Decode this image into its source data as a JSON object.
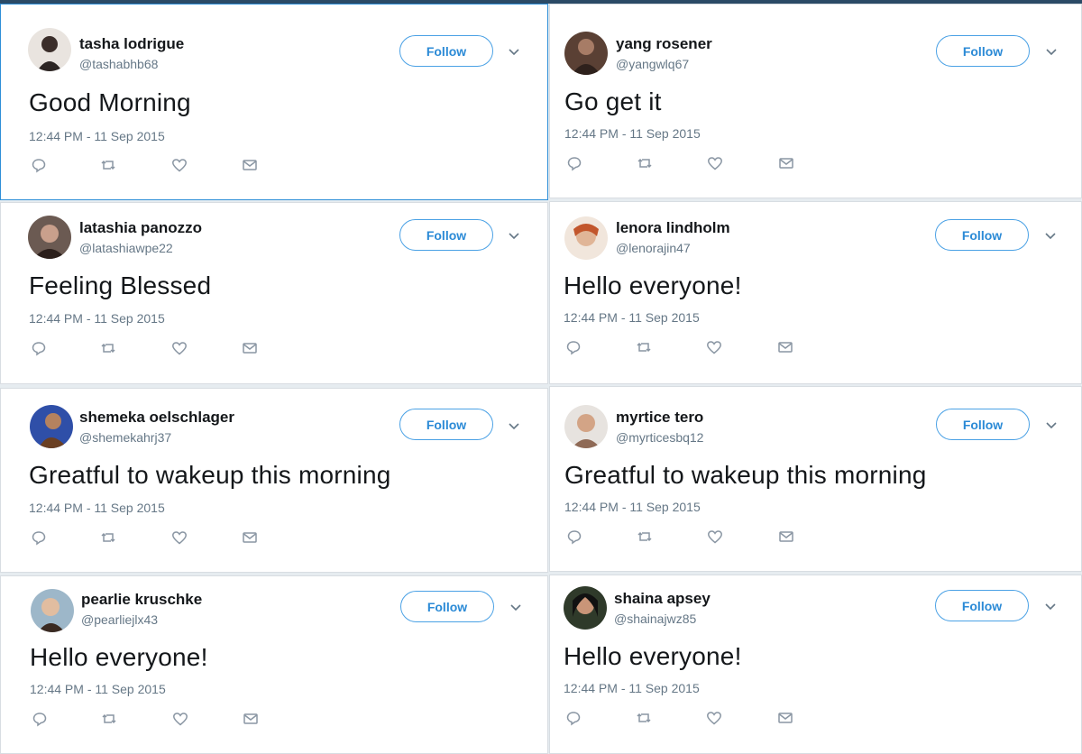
{
  "colors": {
    "accent": "#1da1f2",
    "follow_border": "#4aa1e5",
    "text": "#14171a",
    "muted": "#657786",
    "selected_border": "#2f8fd8"
  },
  "icons": [
    "reply-icon",
    "retweet-icon",
    "like-icon",
    "message-icon",
    "chevron-down-icon"
  ],
  "tweets": [
    {
      "name": "tasha lodrigue",
      "handle": "@tashabhb68",
      "text": "Good Morning",
      "time": "12:44 PM - 11 Sep 2015",
      "follow": "Follow"
    },
    {
      "name": "yang rosener",
      "handle": "@yangwlq67",
      "text": "Go get it",
      "time": "12:44 PM - 11 Sep 2015",
      "follow": "Follow"
    },
    {
      "name": "latashia panozzo",
      "handle": "@latashiawpe22",
      "text": "Feeling Blessed",
      "time": "12:44 PM - 11 Sep 2015",
      "follow": "Follow"
    },
    {
      "name": "lenora lindholm",
      "handle": "@lenorajin47",
      "text": "Hello everyone!",
      "time": "12:44 PM - 11 Sep 2015",
      "follow": "Follow"
    },
    {
      "name": "shemeka oelschlager",
      "handle": "@shemekahrj37",
      "text": "Greatful to wakeup this morning",
      "time": "12:44 PM - 11 Sep 2015",
      "follow": "Follow"
    },
    {
      "name": "myrtice tero",
      "handle": "@myrticesbq12",
      "text": "Greatful to wakeup this morning",
      "time": "12:44 PM - 11 Sep 2015",
      "follow": "Follow"
    },
    {
      "name": "pearlie kruschke",
      "handle": "@pearliejlx43",
      "text": "Hello everyone!",
      "time": "12:44 PM - 11 Sep 2015",
      "follow": "Follow"
    },
    {
      "name": "shaina apsey",
      "handle": "@shainajwz85",
      "text": "Hello everyone!",
      "time": "12:44 PM - 11 Sep 2015",
      "follow": "Follow"
    }
  ]
}
